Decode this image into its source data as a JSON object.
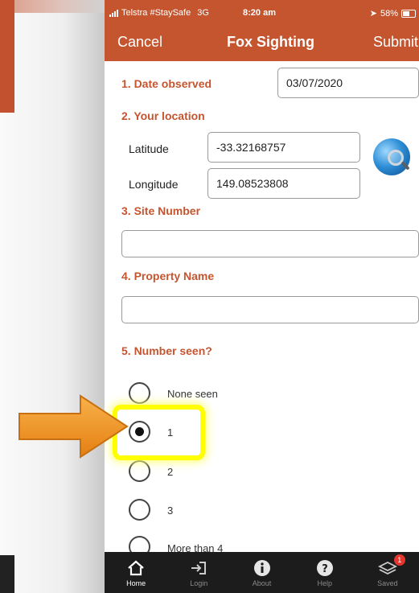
{
  "status": {
    "carrier": "Telstra #StaySafe",
    "network": "3G",
    "time": "8:20 am",
    "battery": "58%"
  },
  "nav": {
    "cancel": "Cancel",
    "title": "Fox Sighting",
    "submit": "Submit"
  },
  "form": {
    "date_label": "1. Date observed",
    "date_value": "03/07/2020",
    "location_label": "2. Your location",
    "latitude_label": "Latitude",
    "latitude_value": "-33.32168757",
    "longitude_label": "Longitude",
    "longitude_value": "149.08523808",
    "site_label": "3. Site Number",
    "site_value": "",
    "property_label": "4. Property Name",
    "property_value": "",
    "number_label": "5. Number seen?",
    "options": [
      "None seen",
      "1",
      "2",
      "3",
      "More than 4"
    ],
    "selected_option": "1"
  },
  "tabs": [
    {
      "label": "Home",
      "icon": "home-icon"
    },
    {
      "label": "Login",
      "icon": "login-icon"
    },
    {
      "label": "About",
      "icon": "info-icon"
    },
    {
      "label": "Help",
      "icon": "help-icon"
    },
    {
      "label": "Saved",
      "icon": "saved-icon",
      "badge": "1"
    }
  ],
  "colors": {
    "accent": "#c5552f",
    "highlight": "#ffff00",
    "arrow": "#f0901f",
    "tabbar": "#1c1c1c"
  }
}
